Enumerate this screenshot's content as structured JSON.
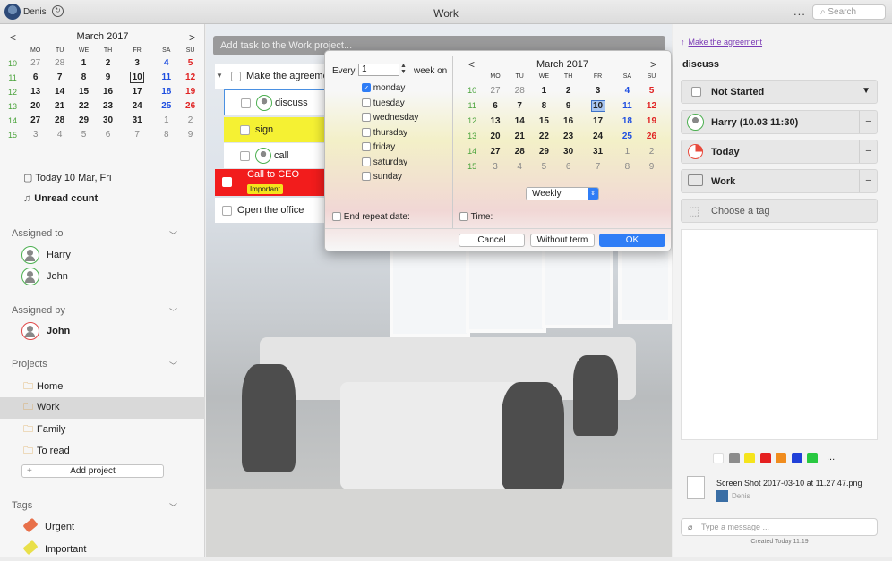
{
  "titlebar": {
    "user": "Denis",
    "title": "Work",
    "more": "...",
    "search_placeholder": "Search"
  },
  "sidebar": {
    "calendar": {
      "prev": "<",
      "next": ">",
      "month": "March 2017",
      "dow": [
        "MO",
        "TU",
        "WE",
        "TH",
        "FR",
        "SA",
        "SU"
      ],
      "weeks": [
        {
          "wk": "10",
          "days": [
            "27",
            "28",
            "1",
            "2",
            "3",
            "4",
            "5"
          ]
        },
        {
          "wk": "11",
          "days": [
            "6",
            "7",
            "8",
            "9",
            "10",
            "11",
            "12"
          ]
        },
        {
          "wk": "12",
          "days": [
            "13",
            "14",
            "15",
            "16",
            "17",
            "18",
            "19"
          ]
        },
        {
          "wk": "13",
          "days": [
            "20",
            "21",
            "22",
            "23",
            "24",
            "25",
            "26"
          ]
        },
        {
          "wk": "14",
          "days": [
            "27",
            "28",
            "29",
            "30",
            "31",
            "1",
            "2"
          ]
        },
        {
          "wk": "15",
          "days": [
            "3",
            "4",
            "5",
            "6",
            "7",
            "8",
            "9"
          ]
        }
      ]
    },
    "today": "Today 10 Mar, Fri",
    "unread": "Unread count",
    "assigned_to": {
      "label": "Assigned to",
      "people": [
        "Harry",
        "John"
      ]
    },
    "assigned_by": {
      "label": "Assigned by",
      "people": [
        "John"
      ]
    },
    "projects": {
      "label": "Projects",
      "items": [
        "Home",
        "Work",
        "Family",
        "To read"
      ],
      "add": "Add project"
    },
    "tags": {
      "label": "Tags",
      "items": [
        "Urgent",
        "Important"
      ]
    }
  },
  "main": {
    "add_task_placeholder": "Add task to the Work project...",
    "tasks": [
      {
        "title": "Make the agreement"
      },
      {
        "title": "discuss"
      },
      {
        "title": "sign"
      },
      {
        "title": "call"
      },
      {
        "title": "Call to CEO",
        "tag": "Important"
      },
      {
        "title": "Open the office"
      }
    ]
  },
  "repeat_popup": {
    "every_label": "Every",
    "every_value": "1",
    "week_on": "week on",
    "days": [
      {
        "name": "monday",
        "checked": true
      },
      {
        "name": "tuesday",
        "checked": false
      },
      {
        "name": "wednesday",
        "checked": false
      },
      {
        "name": "thursday",
        "checked": false
      },
      {
        "name": "friday",
        "checked": false
      },
      {
        "name": "saturday",
        "checked": false
      },
      {
        "name": "sunday",
        "checked": false
      }
    ],
    "end_repeat": "End repeat date:",
    "time": "Time:",
    "frequency": "Weekly",
    "cancel": "Cancel",
    "without_term": "Without term",
    "ok": "OK",
    "calendar": {
      "prev": "<",
      "next": ">",
      "month": "March 2017"
    }
  },
  "details": {
    "link": "Make the agreement",
    "title": "discuss",
    "status": "Not Started",
    "assignee": "Harry (10.03 11:30)",
    "due": "Today",
    "project": "Work",
    "tag_placeholder": "Choose a tag",
    "colors": [
      "#ffffff",
      "#8c8c8c",
      "#f5e41c",
      "#e52020",
      "#f08c1e",
      "#2040d8",
      "#28c840"
    ],
    "colors_more": "...",
    "attachment": {
      "name": "Screen Shot 2017-03-10 at 11.27.47.png",
      "user": "Denis"
    },
    "message_placeholder": "Type a message ...",
    "created": "Created Today 11:19"
  }
}
